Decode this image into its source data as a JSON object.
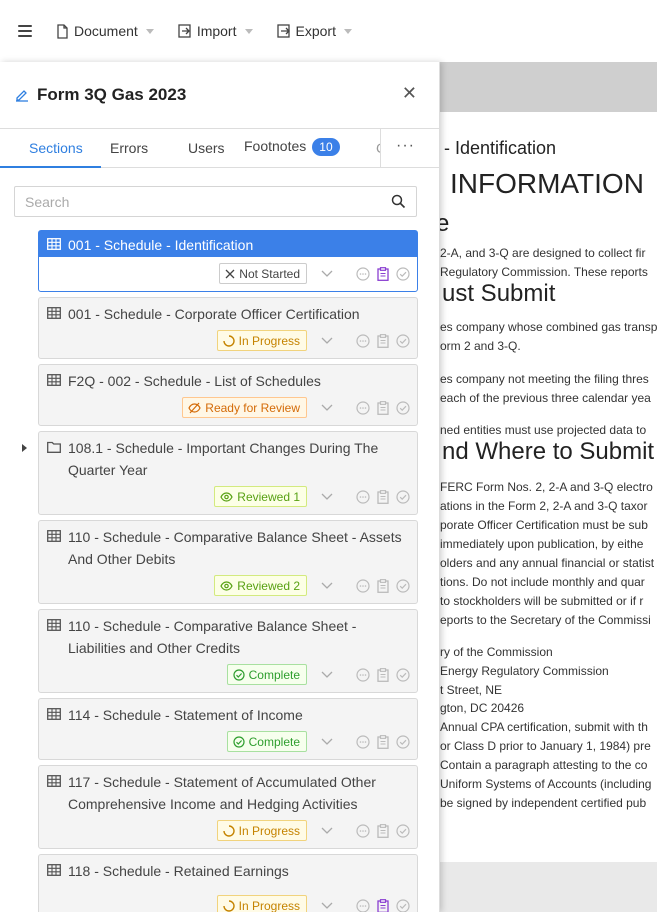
{
  "toolbar": {
    "document_label": "Document",
    "import_label": "Import",
    "export_label": "Export"
  },
  "panel": {
    "title": "Form 3Q Gas 2023",
    "tabs": [
      {
        "label": "Sections"
      },
      {
        "label": "Errors"
      },
      {
        "label": "Users"
      },
      {
        "label": "Footnotes",
        "badge": "10"
      }
    ],
    "search_placeholder": "Search"
  },
  "sections": [
    {
      "title": "001 - Schedule - Identification",
      "status": "Not Started",
      "type": "table"
    },
    {
      "title": "001 - Schedule - Corporate Officer Certification",
      "status": "In Progress",
      "type": "table"
    },
    {
      "title": "F2Q - 002 - Schedule - List of Schedules",
      "status": "Ready for Review",
      "type": "table"
    },
    {
      "title": "108.1 - Schedule - Important Changes During The Quarter Year",
      "status": "Reviewed 1",
      "type": "folder"
    },
    {
      "title": "110 - Schedule - Comparative Balance Sheet - Assets And Other Debits",
      "status": "Reviewed 2",
      "type": "table"
    },
    {
      "title": "110 - Schedule - Comparative Balance Sheet - Liabilities and Other Credits",
      "status": "Complete",
      "type": "table"
    },
    {
      "title": "114 - Schedule - Statement of Income",
      "status": "Complete",
      "type": "table"
    },
    {
      "title": "117 - Schedule - Statement of Accumulated Other Comprehensive Income and Hedging Activities",
      "status": "In Progress",
      "type": "table"
    },
    {
      "title": "118 - Schedule - Retained Earnings",
      "status": "In Progress",
      "type": "table"
    }
  ],
  "document": {
    "lines": [
      "- Identification",
      "INFORMATION",
      "e",
      "2-A, and 3-Q are designed to collect fir",
      "Regulatory Commission. These reports",
      "ust Submit",
      "es company whose combined gas transp",
      "orm 2 and 3-Q.",
      "es company not meeting the filing thres",
      "each of the previous three calendar yea",
      "ned entities must use projected data to",
      "nd Where to Submit",
      "FERC Form Nos. 2, 2-A and 3-Q electro",
      "ations in the Form 2, 2-A and 3-Q taxor",
      "porate Officer Certification must be sub",
      "immediately upon publication, by eithe",
      "olders and any annual financial or statist",
      "tions. Do not include monthly and quar",
      "to stockholders will be submitted or if r",
      "eports to the Secretary of the Commissi",
      "ry of the Commission",
      "Energy Regulatory Commission",
      "t Street, NE",
      "gton, DC 20426",
      "Annual CPA certification, submit with th",
      "or Class D prior to January 1, 1984) pre",
      "Contain a paragraph attesting to the co",
      "Uniform Systems of Accounts (including",
      "be signed by independent certified pub"
    ]
  },
  "colors": {
    "accent": "#3b80e8",
    "in_progress": "#c58300",
    "ready_for_review": "#d46b08",
    "reviewed": "#58a113",
    "complete": "#2e9e2e"
  }
}
